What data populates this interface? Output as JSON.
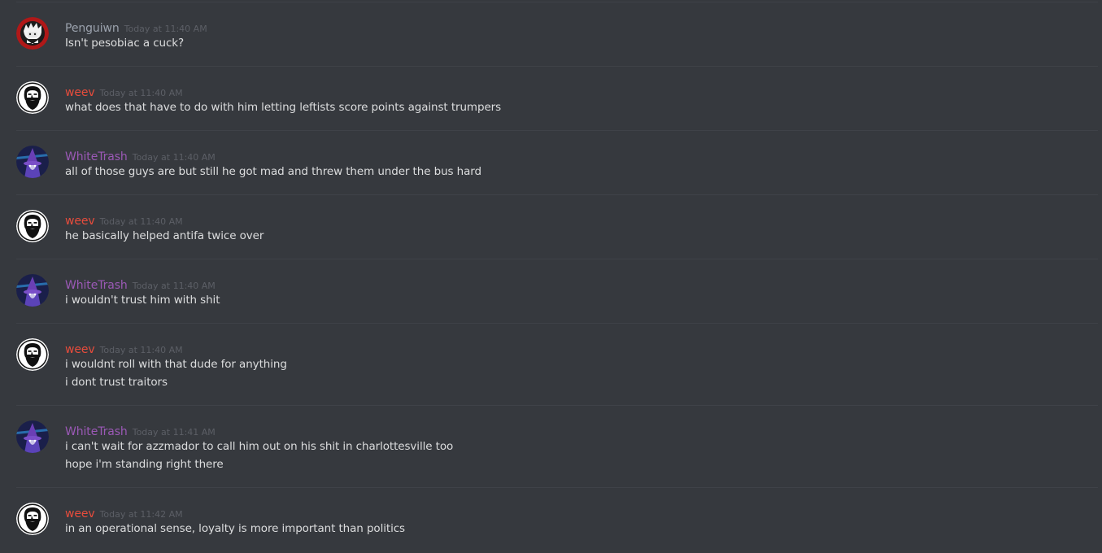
{
  "messages": [
    {
      "username": "Penguiwn",
      "timestamp": "Today at 11:40 AM",
      "lines": [
        "Isn't pesobiac a cuck?"
      ],
      "color": "#9ba2ad",
      "avatar": "red-ring-avatar-icon"
    },
    {
      "username": "weev",
      "timestamp": "Today at 11:40 AM",
      "lines": [
        "what does that have to do with him letting leftists score points against trumpers"
      ],
      "color": "#e74c3c",
      "avatar": "bearded-face-avatar-icon"
    },
    {
      "username": "WhiteTrash",
      "timestamp": "Today at 11:40 AM",
      "lines": [
        "all of those guys are but still he got mad and threw them under the bus hard"
      ],
      "color": "#9b59b6",
      "avatar": "purple-wizard-avatar-icon"
    },
    {
      "username": "weev",
      "timestamp": "Today at 11:40 AM",
      "lines": [
        "he basically helped antifa twice over"
      ],
      "color": "#e74c3c",
      "avatar": "bearded-face-avatar-icon"
    },
    {
      "username": "WhiteTrash",
      "timestamp": "Today at 11:40 AM",
      "lines": [
        "i wouldn't trust him with shit"
      ],
      "color": "#9b59b6",
      "avatar": "purple-wizard-avatar-icon"
    },
    {
      "username": "weev",
      "timestamp": "Today at 11:40 AM",
      "lines": [
        "i wouldnt roll with that dude for anything",
        "i dont trust traitors"
      ],
      "color": "#e74c3c",
      "avatar": "bearded-face-avatar-icon"
    },
    {
      "username": "WhiteTrash",
      "timestamp": "Today at 11:41 AM",
      "lines": [
        "i can't wait for azzmador to call him out on his shit in charlottesville too",
        "hope i'm standing right there"
      ],
      "color": "#9b59b6",
      "avatar": "purple-wizard-avatar-icon"
    },
    {
      "username": "weev",
      "timestamp": "Today at 11:42 AM",
      "lines": [
        "in an operational sense, loyalty is more important than politics"
      ],
      "color": "#e74c3c",
      "avatar": "bearded-face-avatar-icon"
    }
  ]
}
